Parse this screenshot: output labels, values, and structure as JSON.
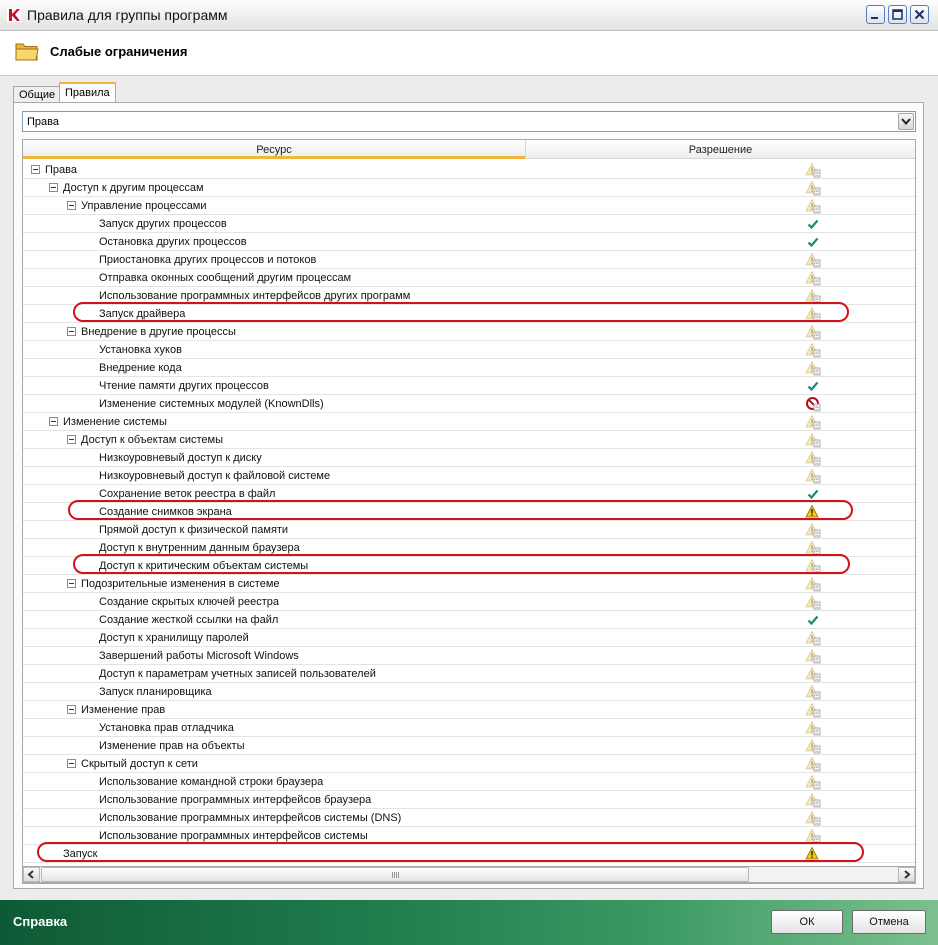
{
  "window": {
    "title": "Правила для группы программ"
  },
  "header": {
    "title": "Слабые ограничения"
  },
  "tabs": [
    {
      "label": "Общие"
    },
    {
      "label": "Правила"
    }
  ],
  "filter": {
    "selected": "Права"
  },
  "columns": {
    "resource": "Ресурс",
    "permission": "Разрешение"
  },
  "rows": [
    {
      "label": "Права",
      "level": 0,
      "toggle": true,
      "perm": "warn-faded"
    },
    {
      "label": "Доступ к другим процессам",
      "level": 1,
      "toggle": true,
      "perm": "warn-faded"
    },
    {
      "label": "Управление процессами",
      "level": 2,
      "toggle": true,
      "perm": "warn-faded"
    },
    {
      "label": "Запуск других процессов",
      "level": 3,
      "toggle": false,
      "perm": "check"
    },
    {
      "label": "Остановка других процессов",
      "level": 3,
      "toggle": false,
      "perm": "check"
    },
    {
      "label": "Приостановка других процессов и потоков",
      "level": 3,
      "toggle": false,
      "perm": "warn-faded"
    },
    {
      "label": "Отправка оконных сообщений другим процессам",
      "level": 3,
      "toggle": false,
      "perm": "warn-faded"
    },
    {
      "label": "Использование программных интерфейсов других программ",
      "level": 3,
      "toggle": false,
      "perm": "warn-faded"
    },
    {
      "label": "Запуск драйвера",
      "level": 3,
      "toggle": false,
      "perm": "warn-faded"
    },
    {
      "label": "Внедрение в другие процессы",
      "level": 2,
      "toggle": true,
      "perm": "warn-faded"
    },
    {
      "label": "Установка хуков",
      "level": 3,
      "toggle": false,
      "perm": "warn-faded"
    },
    {
      "label": "Внедрение кода",
      "level": 3,
      "toggle": false,
      "perm": "warn-faded"
    },
    {
      "label": "Чтение памяти других процессов",
      "level": 3,
      "toggle": false,
      "perm": "check"
    },
    {
      "label": "Изменение системных модулей (KnownDlls)",
      "level": 3,
      "toggle": false,
      "perm": "block"
    },
    {
      "label": "Изменение системы",
      "level": 1,
      "toggle": true,
      "perm": "warn-faded"
    },
    {
      "label": "Доступ к объектам системы",
      "level": 2,
      "toggle": true,
      "perm": "warn-faded"
    },
    {
      "label": "Низкоуровневый доступ к диску",
      "level": 3,
      "toggle": false,
      "perm": "warn-faded"
    },
    {
      "label": "Низкоуровневый доступ к файловой системе",
      "level": 3,
      "toggle": false,
      "perm": "warn-faded"
    },
    {
      "label": "Сохранение веток реестра в файл",
      "level": 3,
      "toggle": false,
      "perm": "check"
    },
    {
      "label": "Создание снимков экрана",
      "level": 3,
      "toggle": false,
      "perm": "warn"
    },
    {
      "label": "Прямой доступ к физической памяти",
      "level": 3,
      "toggle": false,
      "perm": "warn-faded"
    },
    {
      "label": "Доступ к внутренним данным браузера",
      "level": 3,
      "toggle": false,
      "perm": "warn-faded"
    },
    {
      "label": "Доступ к критическим объектам системы",
      "level": 3,
      "toggle": false,
      "perm": "warn-faded"
    },
    {
      "label": "Подозрительные изменения в системе",
      "level": 2,
      "toggle": true,
      "perm": "warn-faded"
    },
    {
      "label": "Создание скрытых ключей реестра",
      "level": 3,
      "toggle": false,
      "perm": "warn-faded"
    },
    {
      "label": "Создание жесткой ссылки на файл",
      "level": 3,
      "toggle": false,
      "perm": "check"
    },
    {
      "label": "Доступ к хранилищу паролей",
      "level": 3,
      "toggle": false,
      "perm": "warn-faded"
    },
    {
      "label": "Завершений работы Microsoft Windows",
      "level": 3,
      "toggle": false,
      "perm": "warn-faded"
    },
    {
      "label": "Доступ к параметрам учетных записей пользователей",
      "level": 3,
      "toggle": false,
      "perm": "warn-faded"
    },
    {
      "label": "Запуск планировщика",
      "level": 3,
      "toggle": false,
      "perm": "warn-faded"
    },
    {
      "label": "Изменение прав",
      "level": 2,
      "toggle": true,
      "perm": "warn-faded"
    },
    {
      "label": "Установка прав отладчика",
      "level": 3,
      "toggle": false,
      "perm": "warn-faded"
    },
    {
      "label": "Изменение прав на объекты",
      "level": 3,
      "toggle": false,
      "perm": "warn-faded"
    },
    {
      "label": "Скрытый доступ к сети",
      "level": 2,
      "toggle": true,
      "perm": "warn-faded"
    },
    {
      "label": "Использование командной строки браузера",
      "level": 3,
      "toggle": false,
      "perm": "warn-faded"
    },
    {
      "label": "Использование программных интерфейсов браузера",
      "level": 3,
      "toggle": false,
      "perm": "warn-faded"
    },
    {
      "label": "Использование программных интерфейсов системы (DNS)",
      "level": 3,
      "toggle": false,
      "perm": "warn-faded"
    },
    {
      "label": "Использование программных интерфейсов системы",
      "level": 3,
      "toggle": false,
      "perm": "warn-faded"
    },
    {
      "label": "Запуск",
      "level": 1,
      "toggle": false,
      "perm": "warn"
    }
  ],
  "highlighted_rows": [
    "Запуск драйвера",
    "Создание снимков экрана",
    "Доступ к критическим объектам системы",
    "Запуск"
  ],
  "footer": {
    "help": "Справка",
    "ok": "ОК",
    "cancel": "Отмена"
  },
  "colors": {
    "accent": "#f3b63c",
    "footer": "#1f7c4d",
    "highlight": "#d0121b",
    "check": "#1a8a74"
  }
}
